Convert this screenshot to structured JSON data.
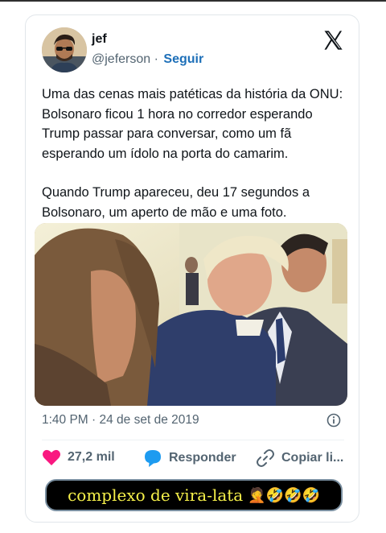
{
  "user": {
    "name": "jef",
    "handle": "@jeferson",
    "separator": "·",
    "follow_label": "Seguir"
  },
  "tweet": {
    "paragraph1": "Uma das cenas mais patéticas da história da ONU: Bolsonaro ficou 1 hora no corredor esperando Trump passar para conversar, como um fã esperando um ídolo na porta do camarim.",
    "paragraph2": "Quando Trump apareceu, deu 17 segundos a Bolsonaro, um aperto de mão e uma foto.",
    "timestamp": "1:40 PM · 24 de set de 2019"
  },
  "actions": {
    "likes": "27,2 mil",
    "reply_label": "Responder",
    "copy_label": "Copiar li..."
  },
  "caption": {
    "text": "complexo de vira-lata",
    "emojis": "🤦🤣🤣🤣"
  },
  "colors": {
    "like": "#f91880",
    "reply": "#1d9bf0",
    "follow": "#1d6fb8",
    "caption_text": "#f7f24a"
  },
  "icons": [
    "x-logo-icon",
    "heart-icon",
    "reply-bubble-icon",
    "link-icon",
    "info-icon"
  ]
}
